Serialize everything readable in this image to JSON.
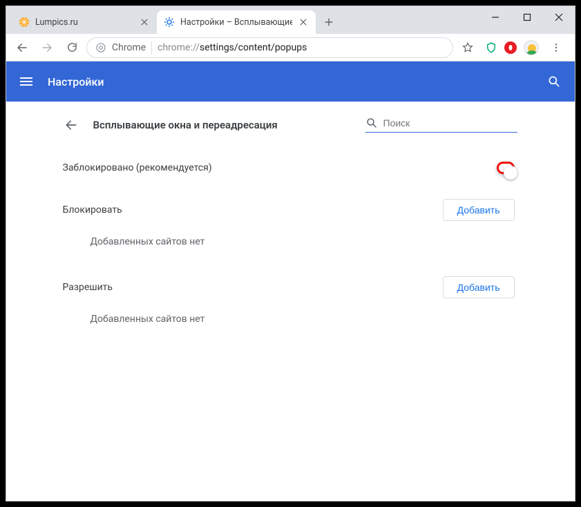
{
  "tabs": [
    {
      "title": "Lumpics.ru"
    },
    {
      "title": "Настройки – Всплывающие окн"
    }
  ],
  "omnibox": {
    "chrome_label": "Chrome",
    "url_prefix": "chrome://",
    "url_path": "settings/content/popups"
  },
  "app": {
    "title": "Настройки",
    "page_title": "Всплывающие окна и переадресация",
    "search_placeholder": "Поиск",
    "blocked_label": "Заблокировано (рекомендуется)",
    "sections": {
      "block": {
        "title": "Блокировать",
        "add_label": "Добавить",
        "empty": "Добавленных сайтов нет"
      },
      "allow": {
        "title": "Разрешить",
        "add_label": "Добавить",
        "empty": "Добавленных сайтов нет"
      }
    }
  }
}
